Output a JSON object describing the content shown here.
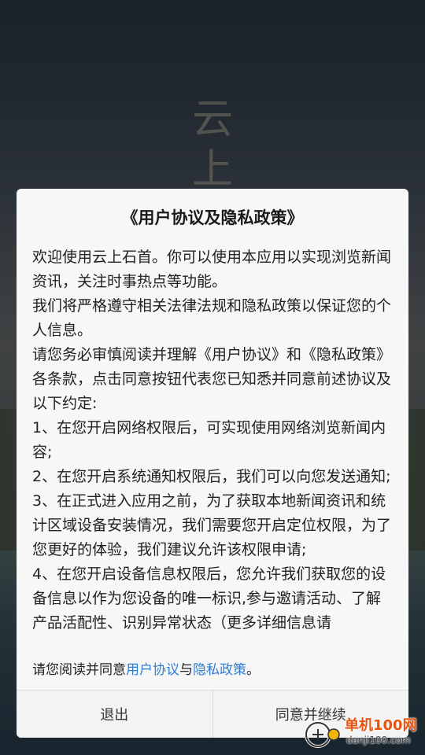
{
  "background": {
    "title_glyphs": "云上"
  },
  "dialog": {
    "title": "《用户协议及隐私政策》",
    "paragraphs": [
      "欢迎使用云上石首。你可以使用本应用以实现浏览新闻资讯，关注时事热点等功能。",
      "我们将严格遵守相关法律法规和隐私政策以保证您的个人信息。",
      "请您务必审慎阅读并理解《用户协议》和《隐私政策》各条款，点击同意按钮代表您已知悉并同意前述协议及以下约定:",
      " 1、在您开启网络权限后，可实现使用网络浏览新闻内容;",
      " 2、在您开启系统通知权限后，我们可以向您发送通知;",
      " 3、在正式进入应用之前，为了获取本地新闻资讯和统计区域设备安装情况，我们需要您开启定位权限，为了您更好的体验，我们建议允许该权限申请;",
      " 4、在您开启设备信息权限后，您允许我们获取您的设备信息以作为您设备的唯一标识,参与邀请活动、了解产品活配性、识别异常状态（更多详细信息请"
    ],
    "consent": {
      "prefix": "请您阅读并同意",
      "user_agreement_link": "用户协议",
      "connector": "与",
      "privacy_policy_link": "隐私政策",
      "suffix": "。"
    },
    "buttons": {
      "exit": "退出",
      "agree": "同意并继续"
    }
  },
  "watermark": {
    "name": "单机100网",
    "url": "danji100.com"
  },
  "colors": {
    "link": "#2f7cd3",
    "dialog_bg": "#f7f7f7",
    "watermark_orange": "#e8540f"
  }
}
